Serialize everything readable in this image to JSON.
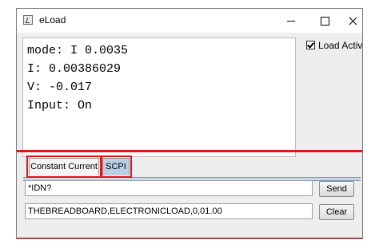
{
  "window": {
    "title": "eLoad"
  },
  "readout": {
    "lines": [
      "mode: I 0.0035",
      "I: 0.00386029",
      "V: -0.017",
      "Input: On"
    ]
  },
  "load_active": {
    "label": "Load Active",
    "checked": true
  },
  "tabs": [
    {
      "label": "Constant Current",
      "selected": false
    },
    {
      "label": "SCPI",
      "selected": true
    }
  ],
  "scpi": {
    "command_value": "*IDN?",
    "response_value": "THEBREADBOARD,ELECTRONICLOAD,0,01.00",
    "send_label": "Send",
    "clear_label": "Clear"
  },
  "colors": {
    "highlight": "#e3141b",
    "selected_tab": "#b8cfe5"
  }
}
